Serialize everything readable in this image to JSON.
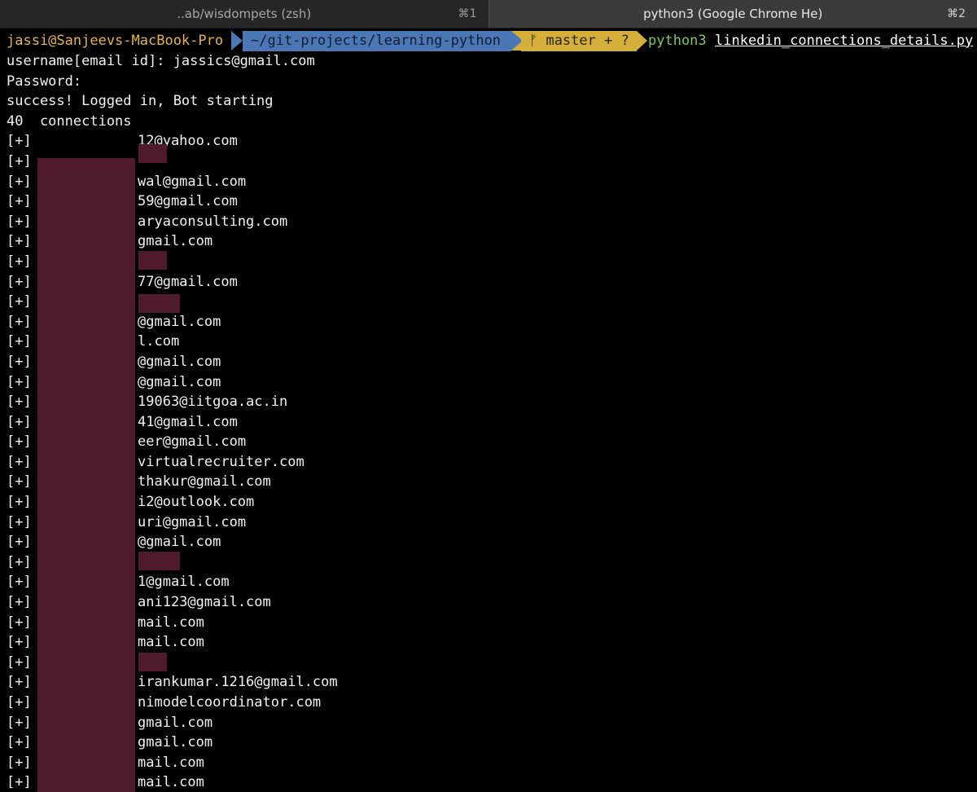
{
  "tabs": [
    {
      "title": "..ab/wisdompets (zsh)",
      "shortcut": "⌘1"
    },
    {
      "title": "python3 (Google Chrome He)",
      "shortcut": "⌘2"
    }
  ],
  "prompt": {
    "user_host": "jassi@Sanjeevs-MacBook-Pro",
    "path": "~/git-projects/learning-python",
    "branch_icon": "git-branch-icon",
    "branch_glyph": "ᚠ",
    "branch": "master + ?",
    "command": "python3",
    "argument": "linkedin_connections_details.py"
  },
  "output": {
    "username_line": "username[email id]: jassics@gmail.com",
    "password_line": "Password:",
    "success_line": "success! Logged in, Bot starting",
    "count_line": "40  connections"
  },
  "connections": {
    "marker": "[+]",
    "rows": [
      "12@yahoo.com",
      "",
      "wal@gmail.com",
      "59@gmail.com",
      "aryaconsulting.com",
      "gmail.com",
      "",
      "77@gmail.com",
      "",
      "@gmail.com",
      "l.com",
      "@gmail.com",
      "@gmail.com",
      "19063@iitgoa.ac.in",
      "41@gmail.com",
      "eer@gmail.com",
      "virtualrecruiter.com",
      "thakur@gmail.com",
      "i2@outlook.com",
      "uri@gmail.com",
      "@gmail.com",
      "",
      "1@gmail.com",
      "ani123@gmail.com",
      "mail.com",
      "mail.com",
      "",
      "irankumar.1216@gmail.com",
      "nimodelcoordinator.com",
      "gmail.com",
      "gmail.com",
      "mail.com",
      "mail.com"
    ]
  },
  "colors": {
    "background": "#000000",
    "redaction": "#4f1a2b",
    "path_segment": "#4b78b5",
    "branch_segment": "#d4b03b",
    "user_host": "#e6b34a",
    "command": "#7ec85e"
  }
}
